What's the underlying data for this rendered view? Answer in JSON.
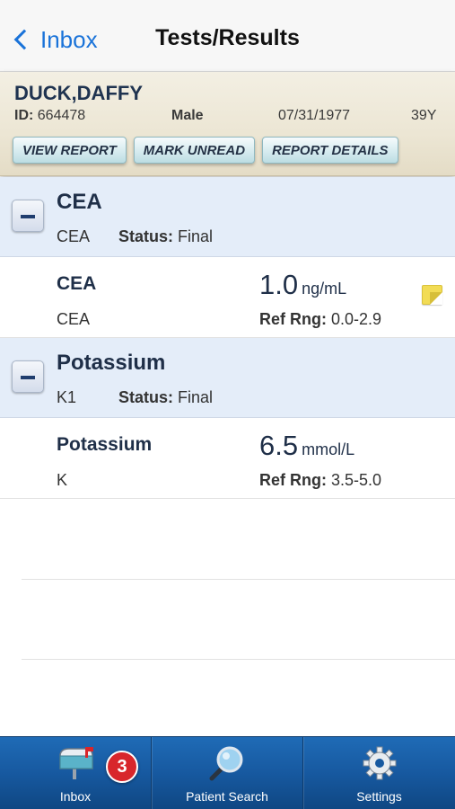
{
  "nav": {
    "back_label": "Inbox",
    "title": "Tests/Results"
  },
  "patient": {
    "name": "DUCK,DAFFY",
    "id_label": "ID:",
    "id": "664478",
    "sex": "Male",
    "dob": "07/31/1977",
    "age": "39Y",
    "buttons": {
      "view_report": "VIEW REPORT",
      "mark_unread": "MARK UNREAD",
      "report_details": "REPORT DETAILS"
    }
  },
  "groups": [
    {
      "title": "CEA",
      "code": "CEA",
      "status_label": "Status:",
      "status": "Final",
      "result": {
        "name": "CEA",
        "code": "CEA",
        "value": "1.0",
        "unit": "ng/mL",
        "ref_label": "Ref Rng:",
        "ref_range": "0.0-2.9",
        "has_note": true
      }
    },
    {
      "title": "Potassium",
      "code": "K1",
      "status_label": "Status:",
      "status": "Final",
      "result": {
        "name": "Potassium",
        "code": "K",
        "value": "6.5",
        "unit": "mmol/L",
        "ref_label": "Ref Rng:",
        "ref_range": "3.5-5.0",
        "has_note": false
      }
    }
  ],
  "tabbar": {
    "inbox": {
      "label": "Inbox",
      "badge": "3",
      "icon": "mailbox-icon"
    },
    "patient_search": {
      "label": "Patient Search",
      "icon": "magnifier-icon"
    },
    "settings": {
      "label": "Settings",
      "icon": "gear-icon"
    }
  },
  "colors": {
    "accent": "#1a73d9",
    "tabbar": "#1759a0",
    "group_bg": "#e4edf9",
    "badge": "#d8262b",
    "note": "#f2dc55"
  }
}
